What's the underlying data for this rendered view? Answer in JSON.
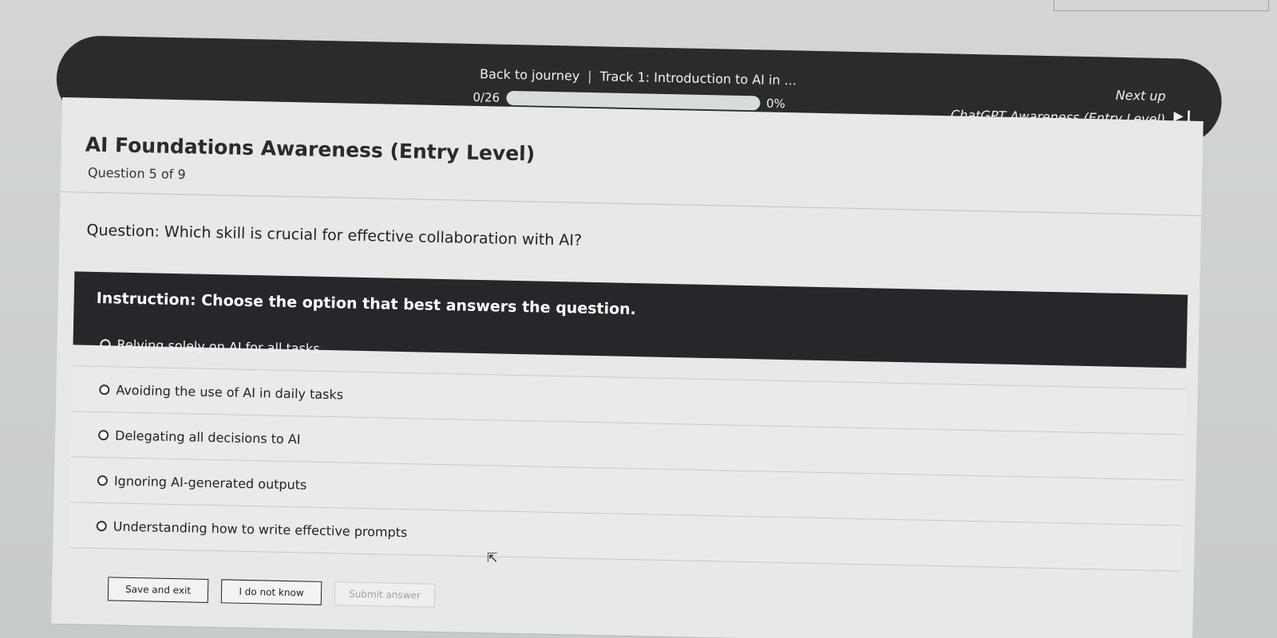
{
  "header": {
    "back_label": "Back to journey",
    "separator": "|",
    "track_title": "Track 1: Introduction to AI in ...",
    "progress_count": "0/26",
    "progress_percent_label": "0%",
    "progress_fraction": 0,
    "next_up_label": "Next up",
    "next_up_title": "ChatGPT Awareness (Entry Level)",
    "next_icon": "skip-next-icon"
  },
  "content": {
    "title": "AI Foundations Awareness (Entry Level)",
    "subtitle": "Question 5 of 9",
    "question": "Question: Which skill is crucial for effective collaboration with AI?",
    "instruction": "Instruction: Choose the option that best answers the question.",
    "options": [
      "Relying solely on AI for all tasks",
      "Avoiding the use of AI in daily tasks",
      "Delegating all decisions to AI",
      "Ignoring AI-generated outputs",
      "Understanding how to write effective prompts"
    ]
  },
  "actions": {
    "save_exit": "Save and exit",
    "dont_know": "I do not know",
    "submit": "Submit answer"
  },
  "colors": {
    "header_bg": "#2a2b2d",
    "instruction_bg": "#25272a",
    "card_bg": "#e7e9e9"
  }
}
